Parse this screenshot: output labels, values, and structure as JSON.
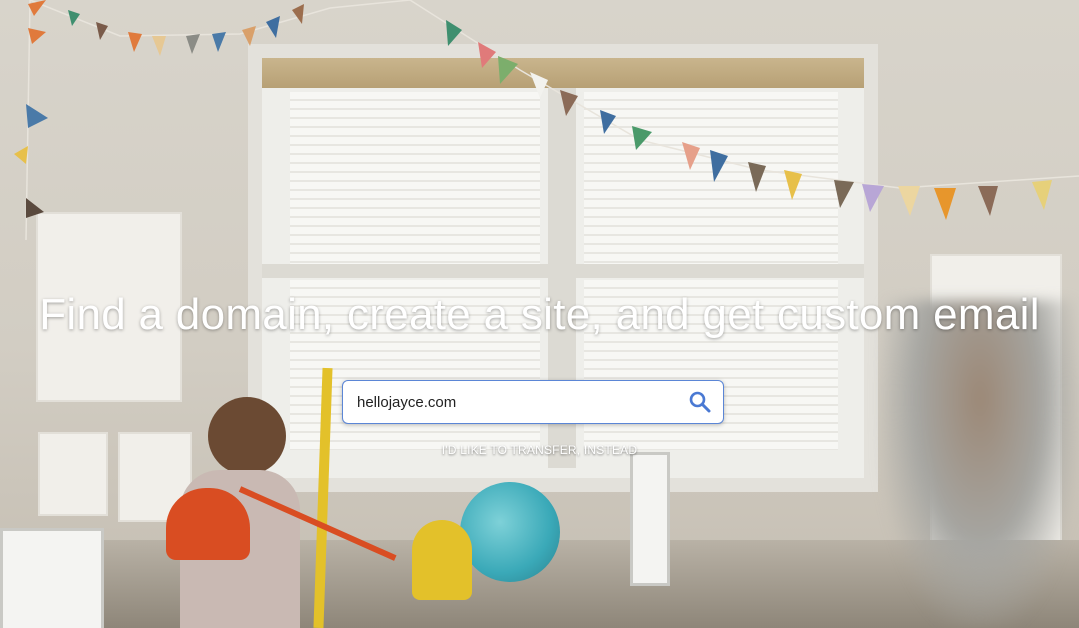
{
  "hero": {
    "title": "Find a domain, create a site, and get custom email"
  },
  "search": {
    "value": "hellojayce.com",
    "icon": "search-icon"
  },
  "transfer": {
    "label": "I'D LIKE TO TRANSFER, INSTEAD"
  },
  "colors": {
    "accent": "#4a79d3",
    "title_text": "#ffffff"
  }
}
